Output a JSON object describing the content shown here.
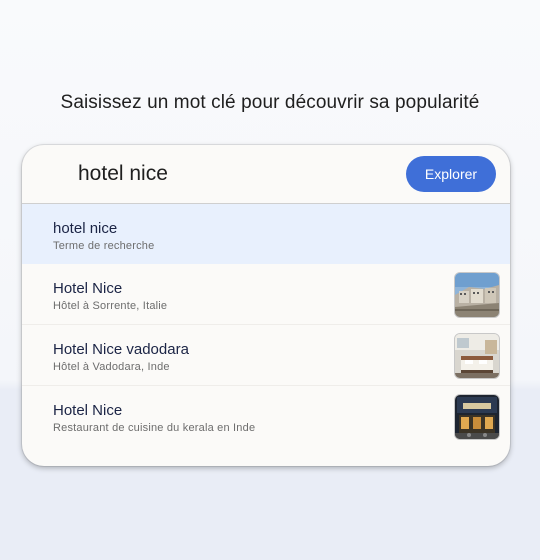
{
  "heading": "Saisissez un mot clé pour découvrir sa popularité",
  "search": {
    "value": "hotel nice",
    "button_label": "Explorer"
  },
  "suggestions": [
    {
      "title": "hotel nice",
      "subtitle": "Terme de recherche",
      "thumbnail": null
    },
    {
      "title": "Hotel Nice",
      "subtitle": "Hôtel à Sorrente, Italie",
      "thumbnail": "hotel-building-photo"
    },
    {
      "title": "Hotel Nice vadodara",
      "subtitle": "Hôtel à Vadodara, Inde",
      "thumbnail": "hotel-room-photo"
    },
    {
      "title": "Hotel Nice",
      "subtitle": "Restaurant de cuisine du kerala en Inde",
      "thumbnail": "restaurant-facade-photo"
    }
  ],
  "colors": {
    "accent": "#3f6fd8",
    "selected_row": "#e8f0fd",
    "title_text": "#1b2445"
  }
}
